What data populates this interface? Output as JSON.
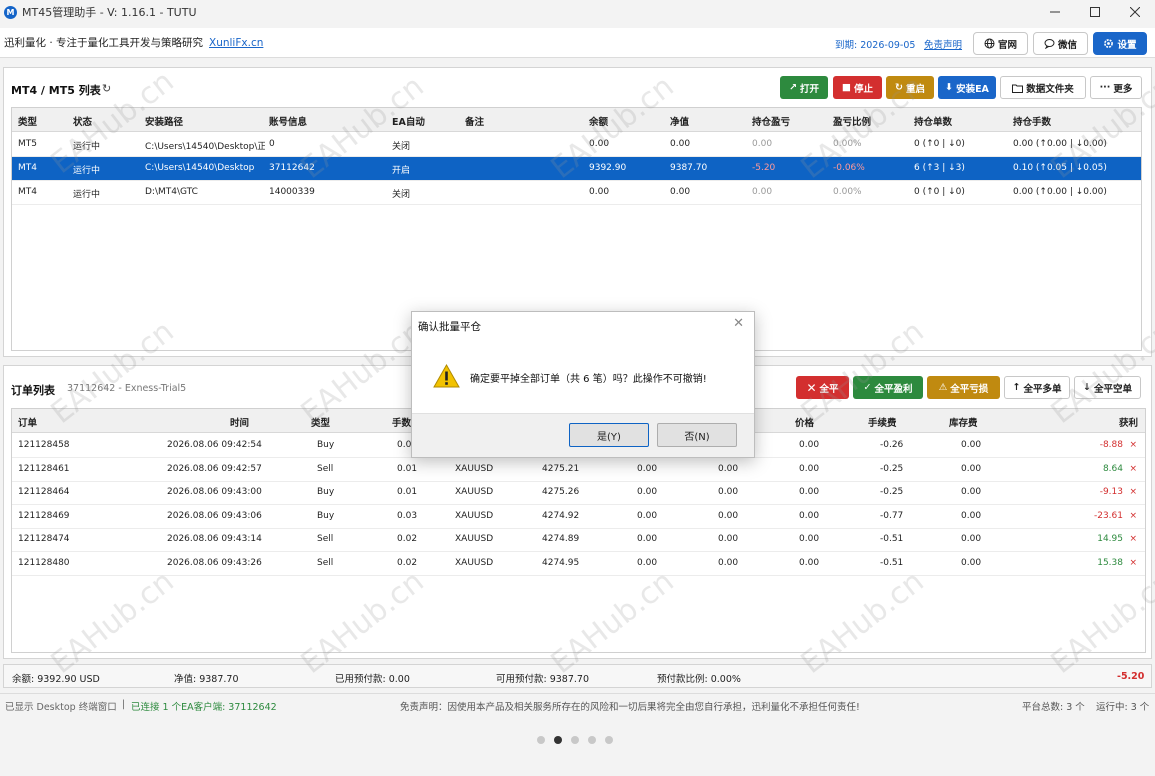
{
  "window": {
    "title": "MT45管理助手 - V: 1.16.1 - TUTU",
    "app_icon": "M"
  },
  "header": {
    "brand": "迅利量化 · 专注于量化工具开发与策略研究",
    "brand_link": "XunliFx.cn",
    "expire": "到期: 2026-09-05",
    "disclaimer_link": "免责声明",
    "btn_site": "官网",
    "btn_wechat": "微信",
    "btn_settings": "设置"
  },
  "terminals": {
    "title": "MT4 / MT5 列表",
    "refresh_icon": "↻",
    "buttons": {
      "open": "打开",
      "stop": "停止",
      "restart": "重启",
      "install_ea": "安装EA",
      "data_folder": "数据文件夹",
      "more": "更多"
    },
    "columns": [
      "类型",
      "状态",
      "安装路径",
      "账号信息",
      "EA自动",
      "备注",
      "余额",
      "净值",
      "持仓盈亏",
      "盈亏比例",
      "持仓单数",
      "持仓手数"
    ],
    "rows": [
      {
        "type": "MT5",
        "status": "运行中",
        "path": "C:\\Users\\14540\\Desktop\\正",
        "account": "0",
        "ea": "关闭",
        "note": "",
        "balance": "0.00",
        "equity": "0.00",
        "pnl": "0.00",
        "ratio": "0.00%",
        "count": "0 (↑0 | ↓0)",
        "lots": "0.00 (↑0.00 | ↓0.00)"
      },
      {
        "type": "MT4",
        "status": "运行中",
        "path": "C:\\Users\\14540\\Desktop",
        "account": "37112642",
        "ea": "开启",
        "note": "",
        "balance": "9392.90",
        "equity": "9387.70",
        "pnl": "-5.20",
        "ratio": "-0.06%",
        "count": "6 (↑3 | ↓3)",
        "lots": "0.10 (↑0.05 | ↓0.05)"
      },
      {
        "type": "MT4",
        "status": "运行中",
        "path": "D:\\MT4\\GTC",
        "account": "14000339",
        "ea": "关闭",
        "note": "",
        "balance": "0.00",
        "equity": "0.00",
        "pnl": "0.00",
        "ratio": "0.00%",
        "count": "0 (↑0 | ↓0)",
        "lots": "0.00 (↑0.00 | ↓0.00)"
      }
    ]
  },
  "orders": {
    "title": "订单列表",
    "subtitle": "37112642 - Exness-Trial5",
    "buttons": {
      "close_all": "全平",
      "close_profit": "全平盈利",
      "close_loss": "全平亏损",
      "close_buy": "全平多单",
      "close_sell": "全平空单"
    },
    "columns": [
      "订单",
      "时间",
      "类型",
      "手数",
      "价格",
      "手续费",
      "库存费",
      "获利"
    ],
    "rows": [
      {
        "id": "121128458",
        "time": "2026.08.06 09:42:54",
        "type": "Buy",
        "lots": "0.01",
        "symbol": "XAUUSD",
        "open": "4275.21",
        "sl": "0.00",
        "tp": "0.00",
        "price": "0.00",
        "commission": "-0.26",
        "swap": "0.00",
        "profit": "-8.88"
      },
      {
        "id": "121128461",
        "time": "2026.08.06 09:42:57",
        "type": "Sell",
        "lots": "0.01",
        "symbol": "XAUUSD",
        "open": "4275.21",
        "sl": "0.00",
        "tp": "0.00",
        "price": "0.00",
        "commission": "-0.25",
        "swap": "0.00",
        "profit": "8.64"
      },
      {
        "id": "121128464",
        "time": "2026.08.06 09:43:00",
        "type": "Buy",
        "lots": "0.01",
        "symbol": "XAUUSD",
        "open": "4275.26",
        "sl": "0.00",
        "tp": "0.00",
        "price": "0.00",
        "commission": "-0.25",
        "swap": "0.00",
        "profit": "-9.13"
      },
      {
        "id": "121128469",
        "time": "2026.08.06 09:43:06",
        "type": "Buy",
        "lots": "0.03",
        "symbol": "XAUUSD",
        "open": "4274.92",
        "sl": "0.00",
        "tp": "0.00",
        "price": "0.00",
        "commission": "-0.77",
        "swap": "0.00",
        "profit": "-23.61"
      },
      {
        "id": "121128474",
        "time": "2026.08.06 09:43:14",
        "type": "Sell",
        "lots": "0.02",
        "symbol": "XAUUSD",
        "open": "4274.89",
        "sl": "0.00",
        "tp": "0.00",
        "price": "0.00",
        "commission": "-0.51",
        "swap": "0.00",
        "profit": "14.95"
      },
      {
        "id": "121128480",
        "time": "2026.08.06 09:43:26",
        "type": "Sell",
        "lots": "0.02",
        "symbol": "XAUUSD",
        "open": "4274.95",
        "sl": "0.00",
        "tp": "0.00",
        "price": "0.00",
        "commission": "-0.51",
        "swap": "0.00",
        "profit": "15.38"
      }
    ],
    "delete_glyph": "×"
  },
  "summary": {
    "balance": "余额: 9392.90 USD",
    "equity": "净值: 9387.70",
    "margin_used": "已用预付款: 0.00",
    "margin_free": "可用预付款: 9387.70",
    "margin_ratio": "预付款比例: 0.00%",
    "total_pnl": "-5.20"
  },
  "footer": {
    "shown": "已显示 Desktop 终端窗口",
    "separator": "|",
    "connected": "已连接 1 个EA客户端: 37112642",
    "disclaimer": "免责声明：因使用本产品及相关服务所存在的风险和一切后果将完全由您自行承担，迅利量化不承担任何责任!",
    "total_platforms": "平台总数: 3 个",
    "running": "运行中: 3 个"
  },
  "dialog": {
    "title": "确认批量平仓",
    "message": "确定要平掉全部订单（共 6 笔）吗？此操作不可撤销!",
    "yes": "是(Y)",
    "no": "否(N)"
  },
  "watermark": "EAHub.cn",
  "colors": {
    "accent": "#1a66c9",
    "green": "#2d8a3e",
    "red": "#d32f2f",
    "amber": "#c08a10",
    "selected_row": "#0e63c4"
  }
}
